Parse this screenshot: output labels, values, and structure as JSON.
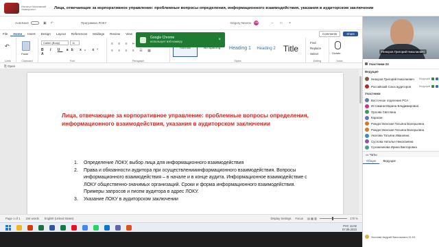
{
  "conference": {
    "logo_text": "Институт Московский Университет",
    "title": "Лица, отвечающие за корпоративное управление: проблемные вопросы определения, информационного взаимодействия, указания в аудиторском заключении"
  },
  "word": {
    "autosave": "AutoSave",
    "docname": "Программа ЛОКУ",
    "user": "Grigory Nevrov",
    "user_initials": "GN",
    "menu": [
      "File",
      "Home",
      "Insert",
      "Design",
      "Layout",
      "References",
      "Mailings",
      "Review",
      "View",
      "Help",
      "Acrobat"
    ],
    "comments": "Comments",
    "share": "Share",
    "ribbon": {
      "paste": "Paste",
      "font_name": "Calibri (Body)",
      "font_size": "11",
      "groups": [
        "Undo",
        "Clipboard",
        "Font",
        "Paragraph",
        "Styles",
        "Editing",
        "Voice"
      ],
      "styles": [
        "Normal",
        "No Spacing",
        "Heading 1",
        "Heading 2",
        "Title"
      ],
      "editing_items": [
        "Find",
        "Replace",
        "Select"
      ],
      "dictate": "Dictate"
    },
    "open_label": "Open",
    "heading": "Лица, отвечающие за корпоративное управление: проблемные вопросы определения, информационного взаимодействия, указания в аудиторском заключении",
    "list": [
      {
        "num": "1.",
        "text": "Определение ЛОКУ, выбор лица для информационного взаимодействия"
      },
      {
        "num": "2.",
        "text": "Права и обязанности аудитора при осуществленииинформационного взаимодействия. Вопросы информационного взаимодействия – в начале и в конце аудита. Информационное взаимодействие с ЛОКУ общественно-значимых организаций. Сроки и форма информационного взаимодействия. Примеры запросов и писем аудитора в адрес ЛОКУ."
      },
      {
        "num": "3.",
        "text": "Указание ЛОКУ в аудиторском заключении"
      }
    ],
    "status": {
      "page": "Page 1 of 1",
      "words": "154 words",
      "language": "English (United States)",
      "display": "Display Settings",
      "focus": "Focus",
      "zoom": "170 %"
    }
  },
  "toast": {
    "title": "Google Chrome",
    "subtitle": "использует вэб-камеру",
    "close": "×"
  },
  "taskbar": {
    "time": "11:02",
    "date": "07.09.2023",
    "lang": "РУС",
    "icon_colors": [
      "#f0b429",
      "#d83b01",
      "#1d6f42",
      "#2b579a",
      "#107c41",
      "#e81123",
      "#4285f4",
      "#25d366",
      "#0078d4",
      "#6264a7",
      "#e04f1a"
    ]
  },
  "panel": {
    "video_name": "Неворов Григорий Николаевич",
    "participants_label": "Участники",
    "participants_count": "24",
    "presenters_label": "Ведущие",
    "presenters": [
      {
        "name": "Неворов Григорий Николаевич",
        "role": "Ведущий",
        "color": "#7a5c3e"
      },
      {
        "name": "Российский Союз аудиторов",
        "role": "Ведущий",
        "color": "#b02a2a"
      }
    ],
    "attendees_label": "Участники",
    "attendees": [
      {
        "name": "Восточное отделение РСА",
        "color": "#5b7fa6"
      },
      {
        "name": "Истомина Марина Владимировна",
        "color": "#c0398a"
      },
      {
        "name": "Орлова Светлана",
        "color": "#3f9a5b"
      },
      {
        "name": "Караски",
        "color": "#6b6bd6"
      },
      {
        "name": "Рождественская Татьяна Валерьевна",
        "color": "#d07a2a"
      },
      {
        "name": "Рождественская Татьяна Валерьевна",
        "color": "#d07a2a"
      },
      {
        "name": "Уколова Татьяна Ивановна",
        "color": "#3a8fb7"
      },
      {
        "name": "Суслова Наталья Николаевна",
        "color": "#8b5a9e"
      },
      {
        "name": "Сухомлинова Ирина Викторовна",
        "color": "#4b9e8a"
      }
    ],
    "chat_label": "Чаты",
    "chat_tabs": [
      "Общие",
      "Ведущие"
    ],
    "chat_message": "Уколова Андрей Васильевич  11:03"
  }
}
